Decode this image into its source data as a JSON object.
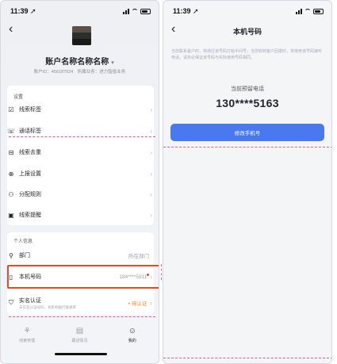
{
  "left_screen": {
    "status": {
      "time": "11:39",
      "location_arrow": "➚"
    },
    "back_icon": "‹",
    "account": {
      "name": "账户名称名称名称",
      "dropdown": "▾",
      "id_text": "账户ID：456187924",
      "business_text": "所属业务：进力智投业务"
    },
    "settings": {
      "label": "设置",
      "items": [
        {
          "icon": "☑",
          "label": "线索标签",
          "value": ""
        },
        {
          "icon": "☏",
          "label": "通话标签",
          "value": ""
        },
        {
          "icon": "⊟",
          "label": "线索去重",
          "value": ""
        },
        {
          "icon": "⊕",
          "label": "上报设置",
          "value": ""
        },
        {
          "icon": "⚇",
          "label": "分配规则",
          "value": ""
        },
        {
          "icon": "▣",
          "label": "线索提醒",
          "value": ""
        }
      ]
    },
    "personal": {
      "label": "个人信息",
      "dept": {
        "icon": "⚲",
        "label": "部门",
        "value": "所在部门"
      },
      "phone": {
        "icon": "▯",
        "label": "本机号码",
        "value": "184****5911"
      },
      "realname": {
        "icon": "⛉",
        "label": "实名认证",
        "sub": "未实名认证号码，会影响拨打接通率",
        "value": "• 待认证"
      }
    },
    "tabs": [
      {
        "icon": "⚘",
        "label": "线索管理",
        "active": false
      },
      {
        "icon": "▤",
        "label": "跟进情况",
        "active": false
      },
      {
        "icon": "☺",
        "label": "我的",
        "active": true
      }
    ],
    "chevron": "›"
  },
  "right_screen": {
    "status": {
      "time": "11:39",
      "location_arrow": "➚"
    },
    "back_icon": "‹",
    "title": "本机号码",
    "notice": "当您联系客户时，将通过该号码打给中间号；当您收到客户回拨时，将使用该号码接听电话。请务必保证该号码与实际使用号码相同。",
    "current_label": "当前预留电话",
    "current_phone": "130****5163",
    "modify_button": "修改手机号"
  },
  "colors": {
    "accent_blue": "#4a78ee",
    "highlight_red": "#e24a2a",
    "pending_orange": "#f08a24"
  }
}
